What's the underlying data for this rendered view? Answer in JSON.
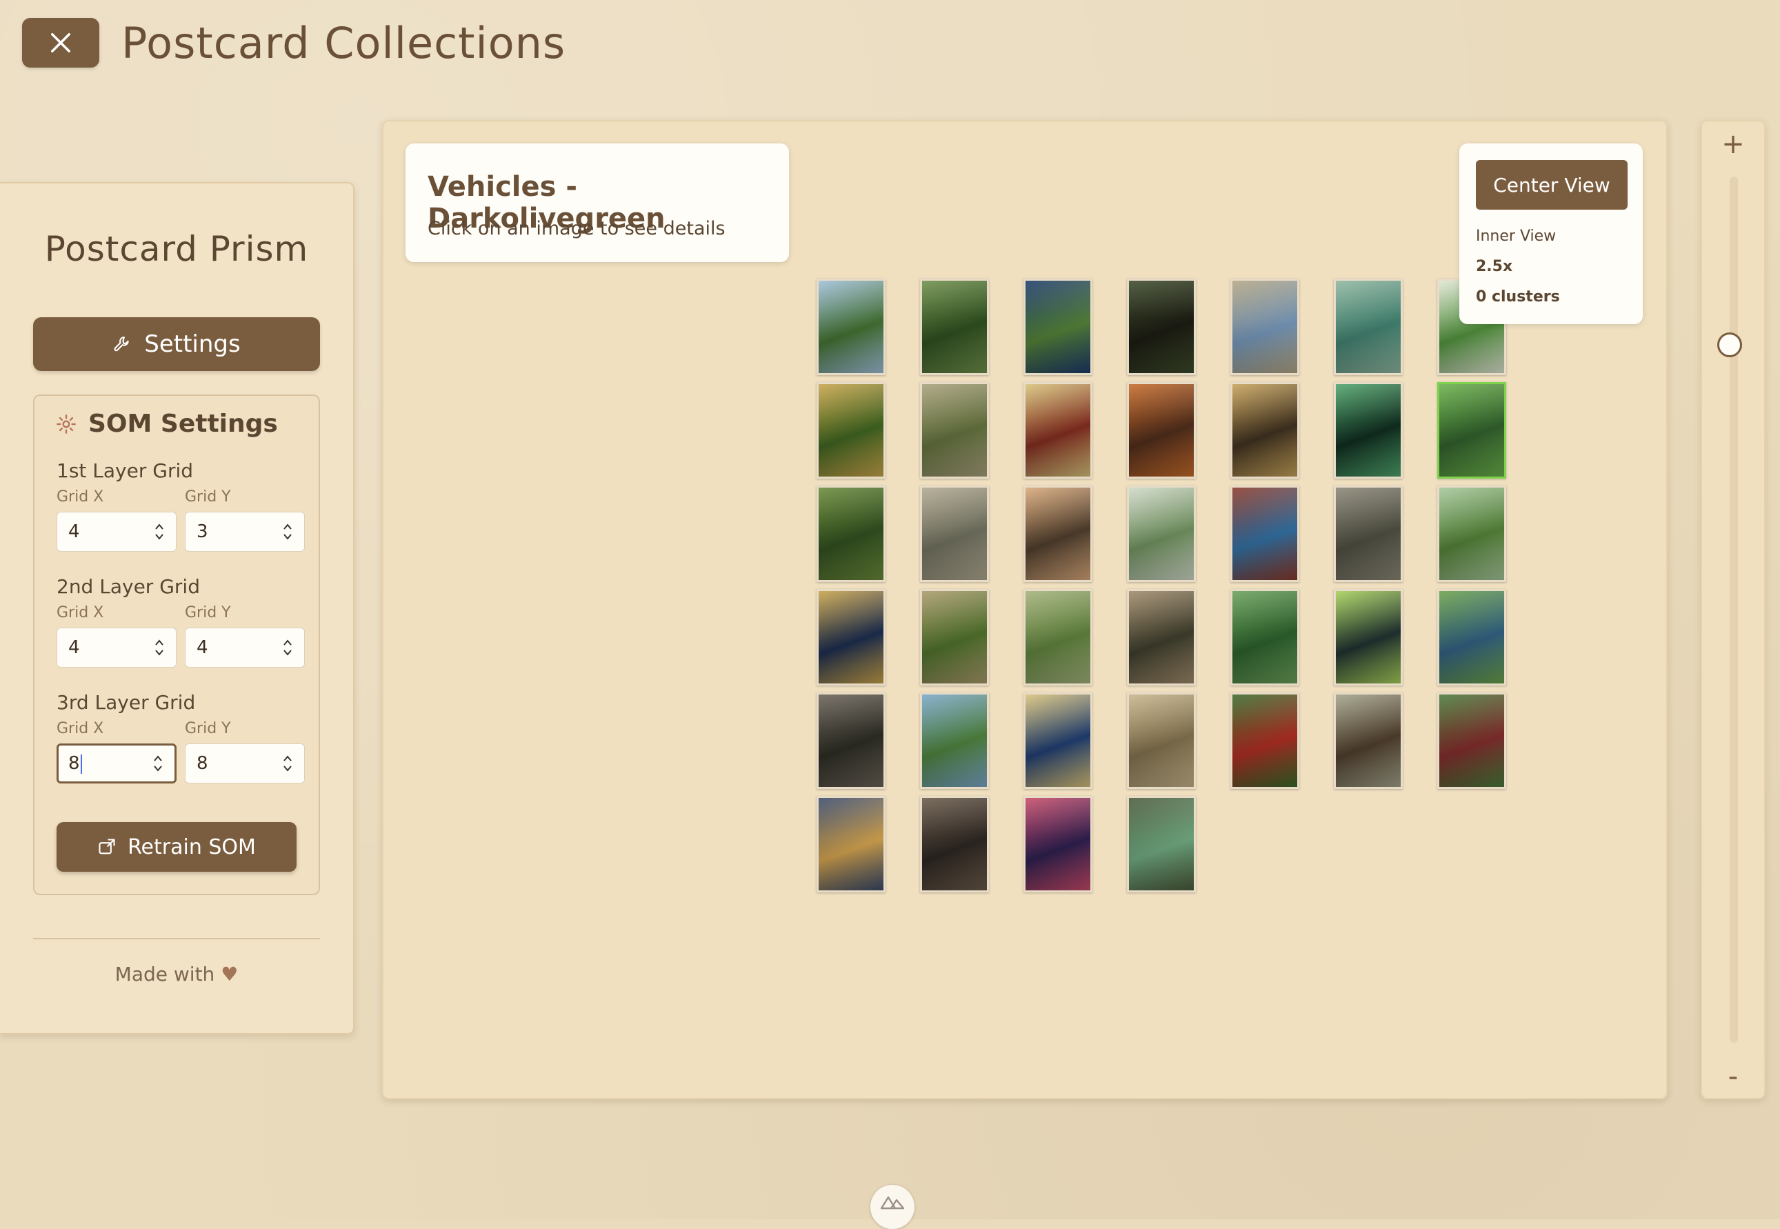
{
  "header": {
    "title": "Postcard Collections",
    "close_icon": "close-icon"
  },
  "sidebar": {
    "title": "Postcard Prism",
    "settings_label": "Settings",
    "som": {
      "title": "SOM Settings",
      "layers": [
        {
          "label": "1st Layer Grid",
          "x_label": "Grid X",
          "y_label": "Grid Y",
          "x": "4",
          "y": "3"
        },
        {
          "label": "2nd Layer Grid",
          "x_label": "Grid X",
          "y_label": "Grid Y",
          "x": "4",
          "y": "4"
        },
        {
          "label": "3rd Layer Grid",
          "x_label": "Grid X",
          "y_label": "Grid Y",
          "x": "8",
          "y": "8"
        }
      ],
      "retrain_label": "Retrain SOM"
    },
    "footer": "Made with"
  },
  "canvas": {
    "info": {
      "title": "Vehicles - Darkolivegreen",
      "subtitle": "Click on an image to see details"
    },
    "view": {
      "center_label": "Center View",
      "mode": "Inner View",
      "zoom": "2.5x",
      "clusters": "0 clusters"
    },
    "thumbnails": [
      {
        "c1": "#3f6a2e",
        "c2": "#9fbfd8"
      },
      {
        "c1": "#2c4a1e",
        "c2": "#6d8f4a"
      },
      {
        "c1": "#4f7a35",
        "c2": "#1e3b6a"
      },
      {
        "c1": "#1a1a12",
        "c2": "#3d4a2a"
      },
      {
        "c1": "#6f8fb0",
        "c2": "#b2a583"
      },
      {
        "c1": "#3e7a6a",
        "c2": "#8fb6a0"
      },
      {
        "c1": "#4d8a3a",
        "c2": "#dfe6d2"
      },
      {
        "c1": "#3b5e1f",
        "c2": "#c7a44a"
      },
      {
        "c1": "#5d6b3a",
        "c2": "#a7a07a"
      },
      {
        "c1": "#7a2a1e",
        "c2": "#d8c27a"
      },
      {
        "c1": "#4a2a1a",
        "c2": "#c56a2a"
      },
      {
        "c1": "#3b2e1e",
        "c2": "#c7a25a"
      },
      {
        "c1": "#0f2a1e",
        "c2": "#4fa36a"
      },
      {
        "c1": "#2f5a2a",
        "c2": "#6ab04a"
      },
      {
        "c1": "#2e4a1e",
        "c2": "#6a8a3a"
      },
      {
        "c1": "#6a6a5a",
        "c2": "#b0a890"
      },
      {
        "c1": "#4a3a2a",
        "c2": "#d8a87a"
      },
      {
        "c1": "#6a8a5a",
        "c2": "#d0d8c8"
      },
      {
        "c1": "#2f6a9a",
        "c2": "#8a3a2a"
      },
      {
        "c1": "#4a4a3e",
        "c2": "#8a8676"
      },
      {
        "c1": "#4f7a35",
        "c2": "#a6c79a"
      },
      {
        "c1": "#1a2a4a",
        "c2": "#c7a24a"
      },
      {
        "c1": "#4a6a2a",
        "c2": "#a89a6a"
      },
      {
        "c1": "#5a7a3a",
        "c2": "#a3b27a"
      },
      {
        "c1": "#3a3a2a",
        "c2": "#a08a6a"
      },
      {
        "c1": "#2a5a2a",
        "c2": "#6aa05a"
      },
      {
        "c1": "#1e2e2e",
        "c2": "#a6d05a"
      },
      {
        "c1": "#2f5a7a",
        "c2": "#6aa04a"
      },
      {
        "c1": "#2a2a22",
        "c2": "#6a6258"
      },
      {
        "c1": "#4a7a3a",
        "c2": "#7aa6c7"
      },
      {
        "c1": "#1e3a6a",
        "c2": "#d8c27a"
      },
      {
        "c1": "#7a6a4a",
        "c2": "#c7b48a"
      },
      {
        "c1": "#a32a22",
        "c2": "#3a6a2a"
      },
      {
        "c1": "#4a3a2a",
        "c2": "#a3a28a"
      },
      {
        "c1": "#7a2a2a",
        "c2": "#4a7a3a"
      },
      {
        "c1": "#c79a4a",
        "c2": "#3a4a6a"
      },
      {
        "c1": "#2a2420",
        "c2": "#6a5a4a"
      },
      {
        "c1": "#2a1e4a",
        "c2": "#c74a6a"
      },
      {
        "c1": "#6aa07a",
        "c2": "#4a5a3a"
      }
    ]
  },
  "zoom": {
    "plus": "+",
    "minus": "-"
  },
  "colors": {
    "accent": "#7a5c3e",
    "background": "#eadbbd",
    "panel": "#f3e3c6",
    "selected": "#7fd24c"
  }
}
